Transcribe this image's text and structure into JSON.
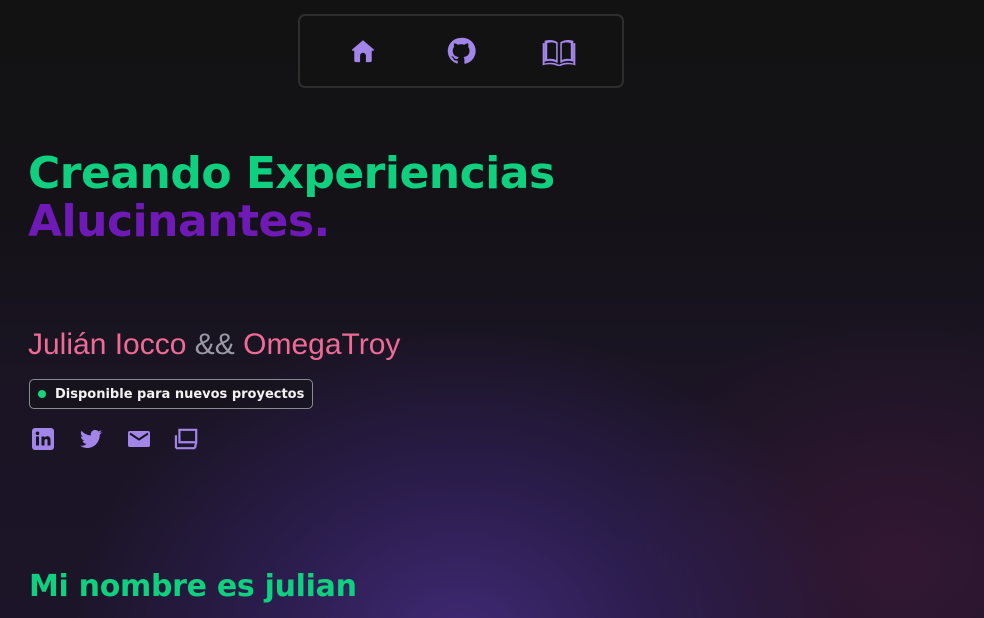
{
  "nav": {
    "items": [
      {
        "icon": "home-icon"
      },
      {
        "icon": "github-icon"
      },
      {
        "icon": "book-open-icon"
      }
    ]
  },
  "hero": {
    "title_line1": "Creando Experiencias",
    "title_line2": "Alucinantes."
  },
  "names": {
    "first": "Julián Iocco",
    "separator": "&&",
    "second": "OmegaTroy"
  },
  "status_badge": {
    "label": "Disponible para nuevos proyectos"
  },
  "socials": [
    {
      "icon": "linkedin-icon"
    },
    {
      "icon": "twitter-icon"
    },
    {
      "icon": "mail-icon"
    },
    {
      "icon": "laptop-icon"
    }
  ],
  "about": {
    "heading": "Mi nombre es julian"
  },
  "colors": {
    "accent_green": "#0fd07f",
    "accent_purple": "#6f19b7",
    "icon_purple": "#a285e8",
    "name_pink": "#ef6a97",
    "status_green": "#17d57f",
    "background": "#121212"
  }
}
